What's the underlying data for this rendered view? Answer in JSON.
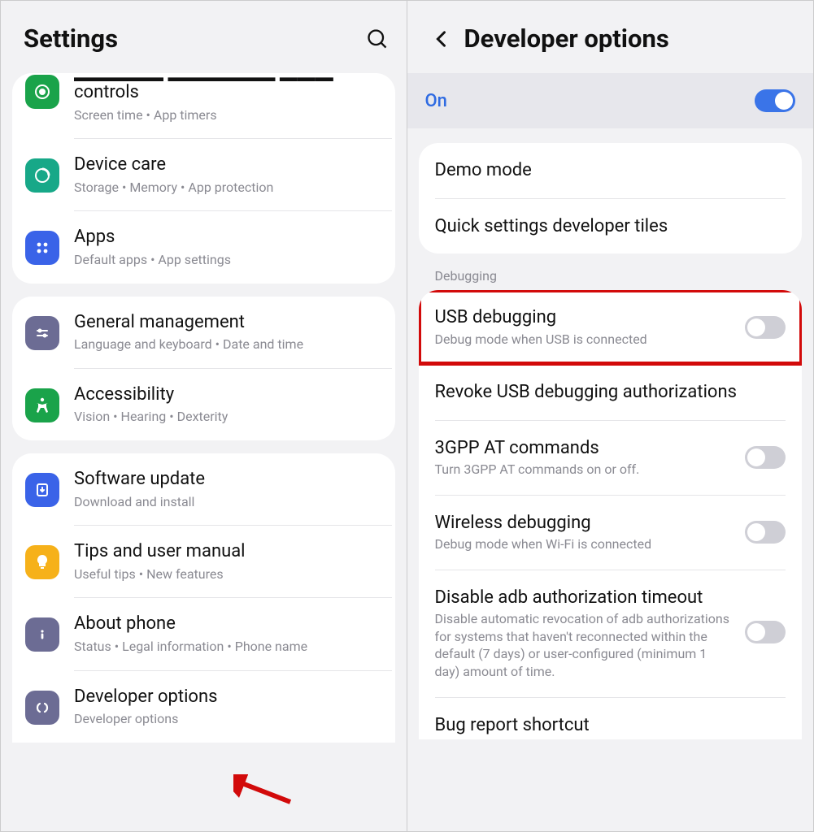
{
  "left": {
    "title": "Settings",
    "groups": [
      {
        "items": [
          {
            "icon": "wellbeing",
            "bg": "#1aa34a",
            "title_cut": "Digital Wellbeing and parental",
            "title": "controls",
            "sub": "Screen time  •  App timers"
          },
          {
            "icon": "device-care",
            "bg": "#17a888",
            "title": "Device care",
            "sub": "Storage  •  Memory  •  App protection"
          },
          {
            "icon": "apps",
            "bg": "#3a63e8",
            "title": "Apps",
            "sub": "Default apps  •  App settings"
          }
        ]
      },
      {
        "items": [
          {
            "icon": "general",
            "bg": "#6c6c94",
            "title": "General management",
            "sub": "Language and keyboard  •  Date and time"
          },
          {
            "icon": "accessibility",
            "bg": "#1aa34a",
            "title": "Accessibility",
            "sub": "Vision  •  Hearing  •  Dexterity"
          }
        ]
      },
      {
        "items": [
          {
            "icon": "update",
            "bg": "#3a63e8",
            "title": "Software update",
            "sub": "Download and install"
          },
          {
            "icon": "tips",
            "bg": "#f6b11a",
            "title": "Tips and user manual",
            "sub": "Useful tips  •  New features"
          },
          {
            "icon": "about",
            "bg": "#6c6c94",
            "title": "About phone",
            "sub": "Status  •  Legal information  •  Phone name"
          },
          {
            "icon": "developer",
            "bg": "#6c6c94",
            "title": "Developer options",
            "sub": "Developer options"
          }
        ]
      }
    ]
  },
  "right": {
    "title": "Developer options",
    "master_toggle": {
      "label": "On"
    },
    "card1": {
      "items": [
        {
          "title": "Demo mode"
        },
        {
          "title": "Quick settings developer tiles"
        }
      ]
    },
    "debugging_label": "Debugging",
    "card2": {
      "items": [
        {
          "title": "USB debugging",
          "sub": "Debug mode when USB is connected",
          "toggle": "off",
          "highlight": true
        },
        {
          "title": "Revoke USB debugging authorizations"
        },
        {
          "title": "3GPP AT commands",
          "sub": "Turn 3GPP AT commands on or off.",
          "toggle": "off"
        },
        {
          "title": "Wireless debugging",
          "sub": "Debug mode when Wi-Fi is connected",
          "toggle": "off"
        },
        {
          "title": "Disable adb authorization timeout",
          "sub": "Disable automatic revocation of adb authorizations for systems that haven't reconnected within the default (7 days) or user-configured (minimum 1 day) amount of time.",
          "toggle": "off"
        },
        {
          "title": "Bug report shortcut"
        }
      ]
    }
  }
}
